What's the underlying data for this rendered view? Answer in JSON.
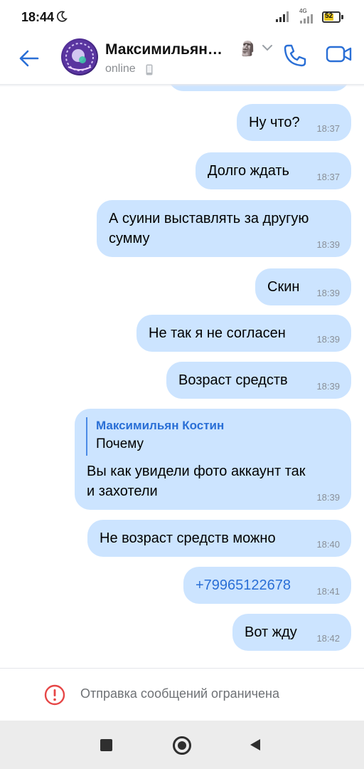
{
  "status_bar": {
    "time": "18:44",
    "network": "4G",
    "battery": "52"
  },
  "header": {
    "contact_name": "Максимильян…",
    "status": "online",
    "emoji": "🗿"
  },
  "messages": [
    {
      "text": "Ну что?",
      "time": "18:37"
    },
    {
      "text": "Долго ждать",
      "time": "18:37"
    },
    {
      "text_lines": [
        "А суини выставлять за другую",
        "сумму"
      ],
      "time": "18:39"
    },
    {
      "text": "Скин",
      "time": "18:39"
    },
    {
      "text": "Не так я не согласен",
      "time": "18:39"
    },
    {
      "text": "Возраст средств",
      "time": "18:39"
    },
    {
      "reply_author": "Максимильян Костин",
      "reply_text": "Почему",
      "text_lines": [
        "Вы как увидели фото аккаунт так",
        "и захотели"
      ],
      "time": "18:39"
    },
    {
      "text": "Не возраст средств можно",
      "time": "18:40"
    },
    {
      "text": "+79965122678",
      "time": "18:41",
      "is_link": true
    },
    {
      "text": "Вот жду",
      "time": "18:42"
    }
  ],
  "restricted": {
    "text": "Отправка сообщений ограничена"
  },
  "colors": {
    "bubble": "#cce4ff",
    "accent": "#2a6fd6",
    "warning": "#e64646"
  }
}
